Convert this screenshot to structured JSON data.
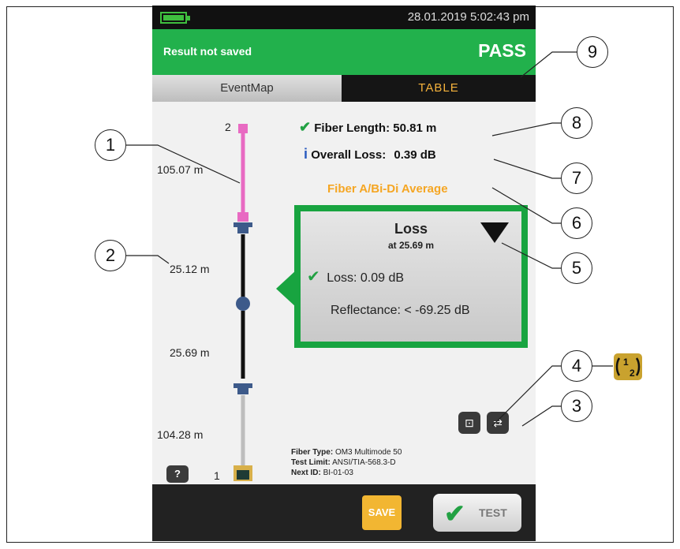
{
  "status_bar": {
    "datetime": "28.01.2019 5:02:43 pm"
  },
  "result_bar": {
    "save_status": "Result not saved",
    "verdict": "PASS"
  },
  "tabs": [
    {
      "label": "EventMap"
    },
    {
      "label": "TABLE"
    }
  ],
  "event_map": {
    "far_end_label": "2",
    "near_end_label": "1",
    "segments": [
      {
        "length": "105.07 m",
        "color": "#e86ac2"
      },
      {
        "length": "25.12 m",
        "color": "#111111"
      },
      {
        "length": "25.69 m",
        "color": "#111111"
      },
      {
        "length": "104.28 m",
        "color": "#bdbdbd"
      }
    ]
  },
  "summary": {
    "fiber_length_label": "Fiber Length:",
    "fiber_length_value": "50.81 m",
    "overall_loss_label": "Overall Loss:",
    "overall_loss_value": "0.39 dB",
    "average_text": "Fiber A/Bi-Di Average"
  },
  "event_popup": {
    "title": "Loss",
    "subtitle": "at 25.69 m",
    "loss_text": "Loss: 0.09 dB",
    "reflectance_text": "Reflectance: < -69.25 dB"
  },
  "test_info": {
    "fiber_type_label": "Fiber Type:",
    "fiber_type_value": "OM3 Multimode 50",
    "test_limit_label": "Test Limit:",
    "test_limit_value": "ANSI/TIA-568.3-D",
    "next_id_label": "Next ID:",
    "next_id_value": "BI-01-03"
  },
  "buttons": {
    "help": "?",
    "save": "SAVE",
    "test": "TEST"
  },
  "callouts": [
    "1",
    "2",
    "3",
    "4",
    "5",
    "6",
    "7",
    "8",
    "9"
  ],
  "colors": {
    "pass_green": "#22b14c",
    "accent_orange": "#f5a623",
    "table_tab_text": "#f5b23c"
  }
}
